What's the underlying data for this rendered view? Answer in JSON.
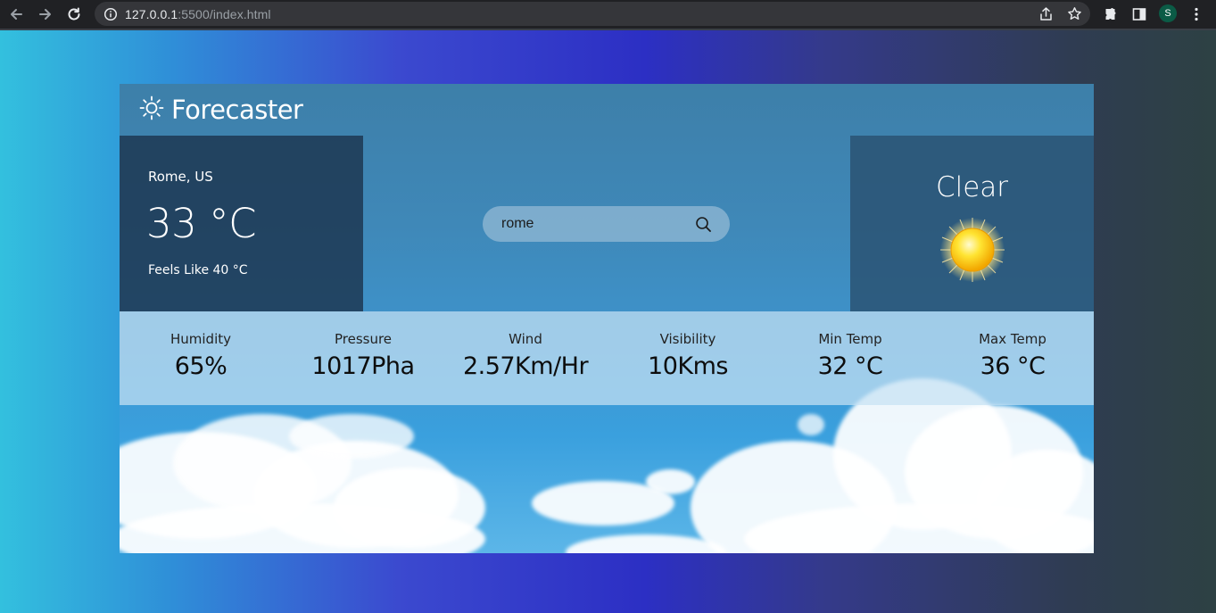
{
  "browser": {
    "url_host": "127.0.0.1",
    "url_rest": ":5500/index.html",
    "profile_initial": "S"
  },
  "app": {
    "brand": "Forecaster",
    "location": "Rome, US",
    "temperature": "33 °C",
    "feels_like": "Feels Like 40 °C",
    "search": {
      "value": "rome"
    },
    "condition": "Clear",
    "stats": [
      {
        "label": "Humidity",
        "value": "65%"
      },
      {
        "label": "Pressure",
        "value": "1017Pha"
      },
      {
        "label": "Wind",
        "value": "2.57Km/Hr"
      },
      {
        "label": "Visibility",
        "value": "10Kms"
      },
      {
        "label": "Min Temp",
        "value": "32 °C"
      },
      {
        "label": "Max Temp",
        "value": "36 °C"
      }
    ]
  },
  "colors": {
    "chrome_bg": "#202124",
    "panel_dark": "#1c344e",
    "stats_bar": "#c6e2f4",
    "sun_yellow": "#ffd21a"
  },
  "icons": [
    "back-icon",
    "forward-icon",
    "reload-icon",
    "info-icon",
    "share-icon",
    "star-icon",
    "extensions-icon",
    "side-panel-icon",
    "menu-icon",
    "sun-logo-icon",
    "search-icon",
    "sun-weather-icon"
  ]
}
